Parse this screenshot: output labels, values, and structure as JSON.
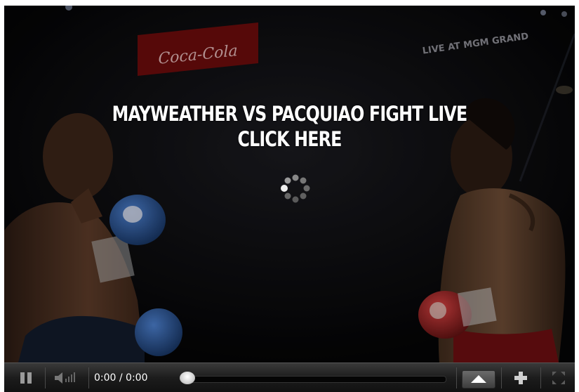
{
  "video": {
    "headline_line1": "MAYWEATHER VS PACQUIAO FIGHT LIVE",
    "headline_line2": "CLICK HERE",
    "loading": true
  },
  "backdrop": {
    "sign_left": "Coca-Cola",
    "sign_right": "LIVE AT MGM GRAND"
  },
  "controls": {
    "time_display": "0:00 / 0:00",
    "progress": 0,
    "pause_icon": "pause-icon",
    "volume_icon": "volume-icon",
    "playlist_icon": "eject-icon",
    "add_icon": "plus-icon",
    "fullscreen_icon": "fullscreen-icon"
  },
  "colors": {
    "overlay": "#000000",
    "text": "#ffffff",
    "controlbar": "#1c1c1c",
    "left_glove": "#2a5ca8",
    "right_glove": "#b8282a"
  }
}
